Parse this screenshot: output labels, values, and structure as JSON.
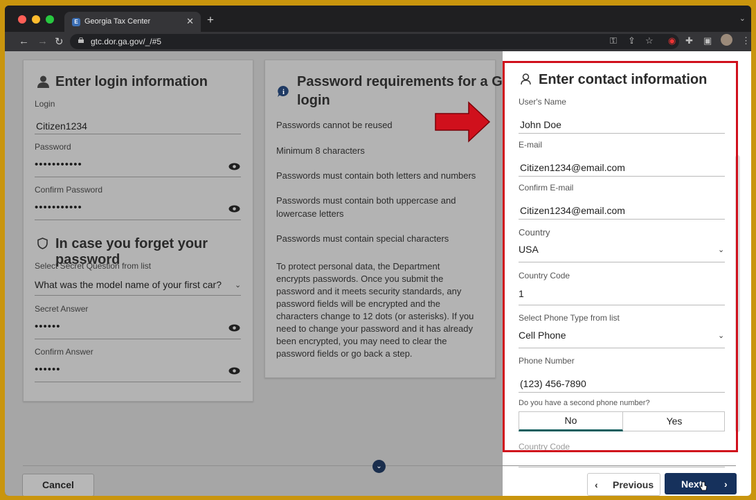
{
  "browser": {
    "tab_title": "Georgia Tax Center",
    "tab_favicon": "E",
    "url": "gtc.dor.ga.gov/_/#5"
  },
  "login_card": {
    "title": "Enter login information",
    "login_label": "Login",
    "login_value": "Citizen1234",
    "password_label": "Password",
    "password_value": "•••••••••••",
    "confirm_password_label": "Confirm Password",
    "confirm_password_value": "•••••••••••",
    "forgot_title": "In case you forget your password",
    "secret_question_label": "Select Secret Question from list",
    "secret_question_value": "What was the model name of your first car?",
    "secret_answer_label": "Secret Answer",
    "secret_answer_value": "••••••",
    "confirm_answer_label": "Confirm Answer",
    "confirm_answer_value": "••••••"
  },
  "requirements_card": {
    "title_line1": "Password requirements for a GTC",
    "title_line2": "login",
    "items": [
      "Passwords cannot be reused",
      "Minimum 8 characters",
      "Passwords must contain both letters and numbers",
      "Passwords must contain both uppercase and",
      "lowercase letters",
      "Passwords must contain special characters"
    ],
    "paragraph_lines": [
      "To protect personal data, the Department",
      "encrypts passwords. Once you submit the",
      "password and it meets security standards, any",
      "password fields will be encrypted and the",
      "characters change to 12 dots (or asterisks). If you",
      "need to change your password and it has already",
      "been encrypted, you may need to clear the",
      "password fields or go back a step."
    ]
  },
  "contact_card": {
    "title": "Enter contact information",
    "name_label": "User's Name",
    "name_value": "John Doe",
    "email_label": "E-mail",
    "email_value": "Citizen1234@email.com",
    "confirm_email_label": "Confirm E-mail",
    "confirm_email_value": "Citizen1234@email.com",
    "country_label": "Country",
    "country_value": "USA",
    "country_code_label": "Country Code",
    "country_code_value": "1",
    "phone_type_label": "Select Phone Type from list",
    "phone_type_value": "Cell Phone",
    "phone_number_label": "Phone Number",
    "phone_number_value": "(123) 456-7890",
    "second_phone_question": "Do you have a second phone number?",
    "option_no": "No",
    "option_yes": "Yes",
    "country_code2_label": "Country Code"
  },
  "footer": {
    "cancel": "Cancel",
    "previous": "Previous",
    "next": "Next"
  },
  "colors": {
    "accent_red": "#d0101c",
    "primary_navy": "#16315c",
    "toggle_selected": "#0d5e5e"
  }
}
